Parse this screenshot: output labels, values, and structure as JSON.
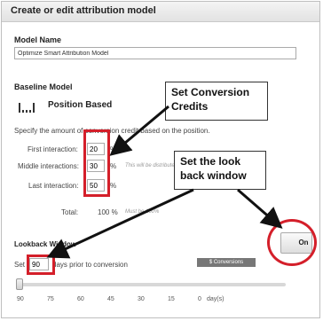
{
  "dialog": {
    "title": "Create or edit attribution model"
  },
  "model_name": {
    "label": "Model Name",
    "value": "Optimize Smart Attribution Model"
  },
  "baseline": {
    "label": "Baseline Model",
    "model": "Position Based",
    "icon": "position-based-chart-icon",
    "description": "Specify the amount of conversion credit based on the position."
  },
  "interactions": [
    {
      "label": "First interaction:",
      "value": "20",
      "unit": "%",
      "note": ""
    },
    {
      "label": "Middle interactions:",
      "value": "30",
      "unit": "%",
      "note": "This will be distributed"
    },
    {
      "label": "Last interaction:",
      "value": "50",
      "unit": "%",
      "note": ""
    }
  ],
  "total": {
    "label": "Total:",
    "value": "100 %",
    "note": "Must be 100%"
  },
  "lookback": {
    "label": "Lookback Window",
    "prefix": "Set",
    "value": "90",
    "suffix": "days prior to conversion",
    "toggle": "On",
    "conversions_chip": "$ Conversions",
    "ticks": [
      "90",
      "75",
      "60",
      "45",
      "30",
      "15",
      "0",
      "day(s)"
    ]
  },
  "annotations": {
    "credits": "Set Conversion Credits",
    "lookback": "Set the look back window",
    "accent": "#d41f2a"
  }
}
